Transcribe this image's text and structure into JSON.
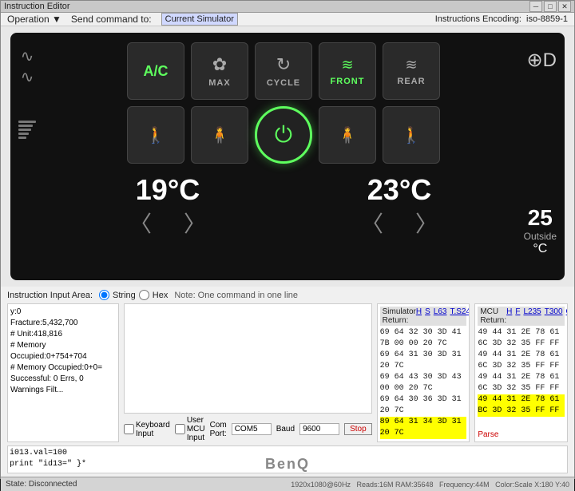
{
  "window": {
    "title": "Instruction Editor",
    "encoding_label": "Instructions Encoding:",
    "encoding_value": "iso-8859-1"
  },
  "menubar": {
    "operation": "Operation ▼",
    "send_command_label": "Send command to:",
    "send_command_value": "Current Simulator"
  },
  "ac_panel": {
    "buttons_row1": [
      {
        "id": "ac",
        "label": "A/C",
        "icon": "",
        "type": "text-icon"
      },
      {
        "id": "max",
        "label": "MAX",
        "icon": "❄",
        "type": "icon"
      },
      {
        "id": "cycle",
        "label": "CYCLE",
        "icon": "♻",
        "type": "icon"
      },
      {
        "id": "front",
        "label": "FRONT",
        "icon": "≋",
        "type": "icon",
        "active": true
      },
      {
        "id": "rear",
        "label": "REAR",
        "icon": "≋",
        "type": "icon"
      }
    ],
    "temp_left": "19°C",
    "temp_right": "23°C",
    "outside_temp": "25",
    "outside_label": "Outside",
    "outside_unit": "°C"
  },
  "simulator_panel": {
    "title": "Simulator Return:",
    "links": [
      "H",
      "S",
      "L63",
      "T.S24",
      "Clear"
    ],
    "lines": [
      "69 64 32 30 3D 41 7B 00 00 20 7C",
      "69 64 31 30 3D 31 20 7C",
      "69 64 43 30 3D 43 00 00 20 7C",
      "69 64 30 36 3D 31 20 7C",
      "89 64 31 34 3D 31 20 7C"
    ],
    "highlighted_line": "89 64 31 34 3D 31 20 7C"
  },
  "mcu_panel": {
    "title": "MCU Return:",
    "links": [
      "H",
      "F",
      "L235",
      "T300",
      "Clear"
    ],
    "lines": [
      "49 44 31 2E 78 61 6C 3D 32 35 FF FF",
      "49 44 31 2E 78 61 6C 3D 32 35 FF FF",
      "49 44 31 2E 78 61 6C 3D 32 35 FF FF",
      "49 44 31 2E 78 61 BC 3D 32 35 FF FF"
    ],
    "highlighted_line": "49 44 31 2E 78 61 BC 3D 32 35 FF FF",
    "parse_label": "Parse"
  },
  "input_area": {
    "label": "Instruction Input Area:",
    "radio1": "String",
    "radio2": "Hex",
    "note": "Note: One command in one line"
  },
  "left_info": {
    "lines": [
      "y:0",
      "Fracture:5,432,700",
      "# Unit:418,816",
      "# Memory Occupied:0+754+704",
      "# Memory Occupied:0+0=",
      "Successful: 0 Errs, 0 Warnings Filt..."
    ]
  },
  "bottom_controls": {
    "keyboard_input": "Keyboard Input",
    "user_mcu": "User MCU Input",
    "com_port_label": "Com Port:",
    "com_port_value": "COM5",
    "baud_label": "Baud",
    "baud_value": "9600",
    "stop_label": "Stop"
  },
  "script_panel": {
    "lines": [
      "i013.val=100",
      "print \"id13=\" }*"
    ]
  },
  "status_bar": {
    "text": "State: Disconnected"
  },
  "bottom_bar": {
    "resolution": "1920x1080@60Hz",
    "ram": "Reads:16M RAM:35648",
    "frequency": "Frequency:44M",
    "color": "Color:Scale X:180 Y:40"
  },
  "monitor": {
    "brand": "BenQ"
  }
}
